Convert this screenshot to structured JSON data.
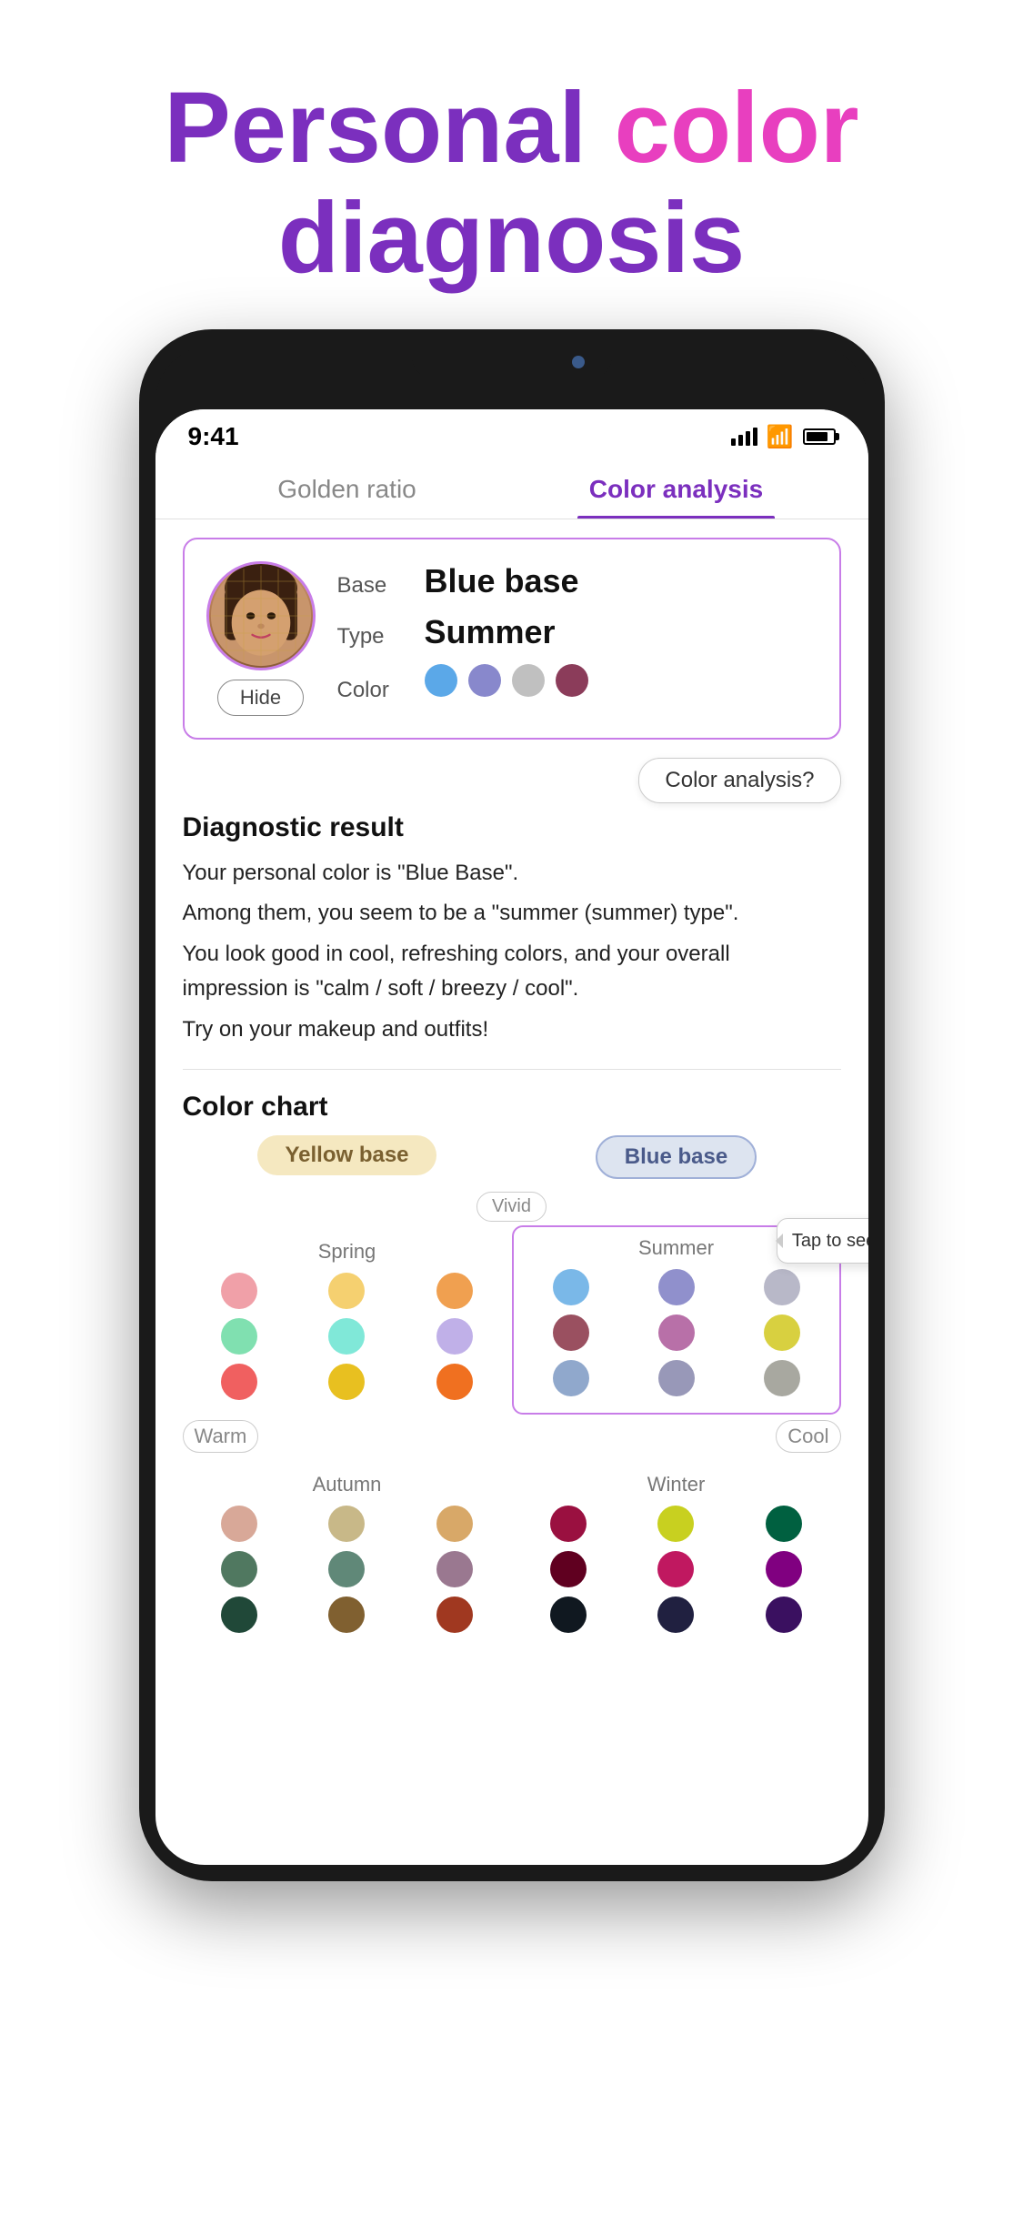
{
  "header": {
    "line1_part1": "Personal ",
    "line1_part2": "color",
    "line2": "diagnosis"
  },
  "status_bar": {
    "time": "9:41",
    "signal": "signal",
    "wifi": "wifi",
    "battery": "battery"
  },
  "tabs": [
    {
      "id": "golden",
      "label": "Golden ratio",
      "active": false
    },
    {
      "id": "color",
      "label": "Color analysis",
      "active": true
    }
  ],
  "result_card": {
    "base_label": "Base",
    "base_value": "Blue base",
    "type_label": "Type",
    "type_value": "Summer",
    "color_label": "Color",
    "colors": [
      {
        "hex": "#5ba8e8",
        "name": "sky-blue"
      },
      {
        "hex": "#8888cc",
        "name": "lavender"
      },
      {
        "hex": "#c0c0c0",
        "name": "silver"
      },
      {
        "hex": "#8b3c5a",
        "name": "mauve"
      }
    ],
    "hide_button": "Hide"
  },
  "color_analysis_btn": "Color analysis?",
  "diagnostic": {
    "title": "Diagnostic result",
    "lines": [
      "Your personal color is \"Blue Base\".",
      "Among them, you seem to be a \"summer (summer) type\".",
      "You look good in cool, refreshing colors, and your overall impression is \"calm / soft / breezy / cool\".",
      "Try on your makeup and outfits!"
    ]
  },
  "color_chart": {
    "title": "Color chart",
    "yellow_base": "Yellow base",
    "blue_base": "Blue base",
    "vivid": "Vivid",
    "warm": "Warm",
    "cool": "Cool",
    "tap_tooltip": "Tap to see the details.",
    "seasons": {
      "spring": {
        "label": "Spring",
        "dots": [
          "#f0a0a8",
          "#f5d070",
          "#f0a050",
          "#80e0b0",
          "#80e8d8",
          "#c0b0e8",
          "#f06060",
          "#e8c020",
          "#f07020"
        ]
      },
      "summer": {
        "label": "Summer",
        "dots": [
          "#7ab8e8",
          "#9090cc",
          "#b8b8c8",
          "#9a5060",
          "#b870a8",
          "#d8d040",
          "#90a8cc",
          "#9898b8",
          "#a8a8a0"
        ]
      },
      "autumn": {
        "label": "Autumn",
        "dots": [
          "#d8a898",
          "#c8b888",
          "#d8a868",
          "#507860",
          "#608878",
          "#9a7890",
          "#202020",
          "#202020",
          "#202020"
        ]
      },
      "winter": {
        "label": "Winter",
        "dots": [
          "#9a1040",
          "#c8d020",
          "#006040",
          "#600020",
          "#c01860",
          "#800080",
          "#101820",
          "#202040",
          "#3a1060"
        ]
      }
    }
  }
}
